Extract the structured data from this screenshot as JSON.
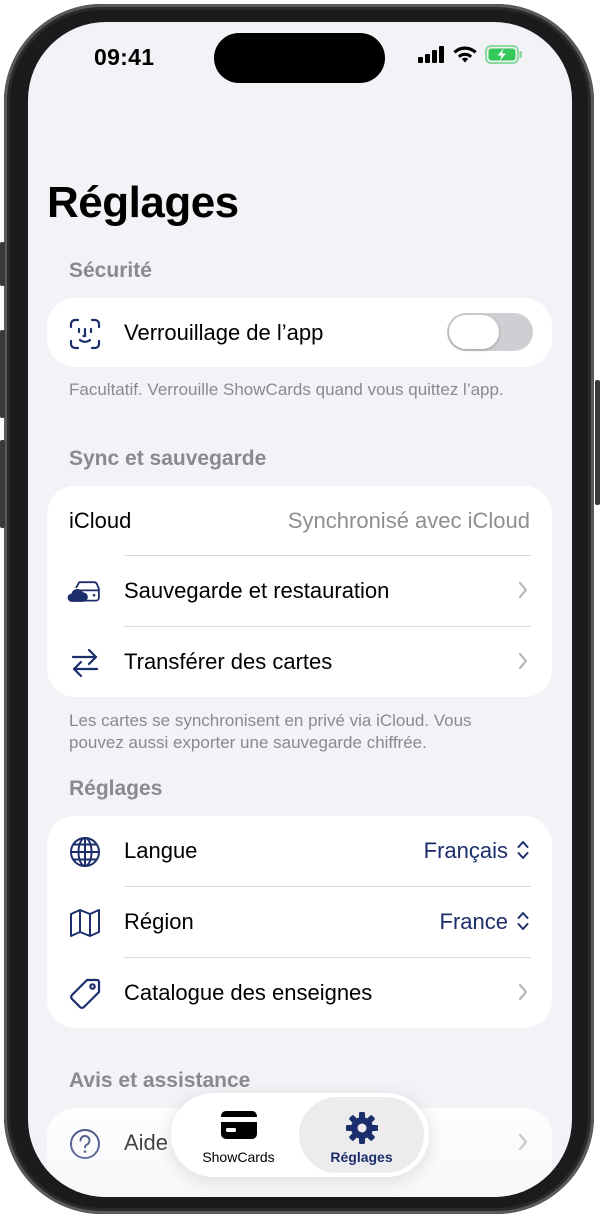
{
  "status_bar": {
    "time": "09:41"
  },
  "page": {
    "title": "Réglages"
  },
  "security": {
    "header": "Sécurité",
    "app_lock_label": "Verrouillage de l’app",
    "app_lock_enabled": false,
    "footer": "Facultatif. Verrouille ShowCards quand vous quittez l’app."
  },
  "sync": {
    "header": "Sync et sauvegarde",
    "icloud_label": "iCloud",
    "icloud_value": "Synchronisé avec iCloud",
    "backup_label": "Sauvegarde et restauration",
    "transfer_label": "Transférer des cartes",
    "footer": "Les cartes se synchronisent en privé via iCloud. Vous pouvez aussi exporter une sauvegarde chiffrée."
  },
  "settings": {
    "header": "Réglages",
    "language_label": "Langue",
    "language_value": "Français",
    "region_label": "Région",
    "region_value": "France",
    "catalog_label": "Catalogue des enseignes"
  },
  "support": {
    "header": "Avis et assistance",
    "help_label": "Aide"
  },
  "tabbar": {
    "tabs": [
      {
        "label": "ShowCards",
        "icon": "card-icon",
        "selected": false
      },
      {
        "label": "Réglages",
        "icon": "gear-icon",
        "selected": true
      }
    ]
  },
  "colors": {
    "accent": "#1c2d6b",
    "background": "#f2f2f7",
    "secondary_text": "#8a8a8e",
    "battery": "#34c759"
  }
}
